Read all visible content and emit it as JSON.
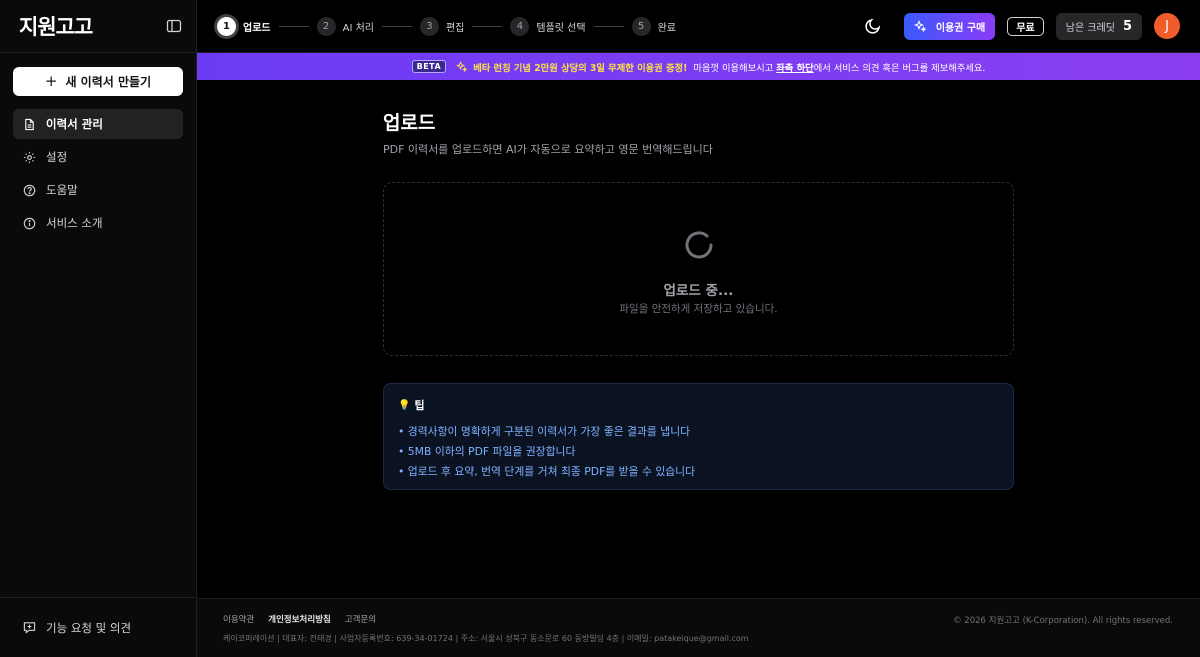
{
  "app": {
    "logo": "지원고고"
  },
  "sidebar": {
    "new_button": "새 이력서 만들기",
    "items": [
      {
        "label": "이력서 관리",
        "icon": "document-icon",
        "active": true
      },
      {
        "label": "설정",
        "icon": "gear-icon",
        "active": false
      },
      {
        "label": "도움말",
        "icon": "help-icon",
        "active": false
      },
      {
        "label": "서비스 소개",
        "icon": "info-icon",
        "active": false
      }
    ],
    "feedback": "기능 요청 및 의견"
  },
  "steps": [
    {
      "num": "1",
      "label": "업로드",
      "active": true
    },
    {
      "num": "2",
      "label": "AI 처리",
      "active": false
    },
    {
      "num": "3",
      "label": "편집",
      "active": false
    },
    {
      "num": "4",
      "label": "템플릿 선택",
      "active": false
    },
    {
      "num": "5",
      "label": "완료",
      "active": false
    }
  ],
  "header": {
    "buy_label": "이용권 구매",
    "plan": "무료",
    "credits_label": "남은 크레딧",
    "credits_value": "5",
    "avatar_initial": "J"
  },
  "banner": {
    "badge": "BETA",
    "highlight": "베타 런칭 기념 2만원 상당의 3일 무제한 이용권 증정!",
    "text_before": "마음껏 이용해보시고",
    "link": "좌측 하단",
    "text_after": "에서 서비스 의견 혹은 버그를 제보해주세요."
  },
  "main": {
    "title": "업로드",
    "subtitle": "PDF 이력서를 업로드하면 AI가 자동으로 요약하고 영문 번역해드립니다",
    "status": "업로드 중...",
    "status_sub": "파일을 안전하게 저장하고 있습니다."
  },
  "tips": {
    "title": "팁",
    "items": [
      "• 경력사항이 명확하게 구분된 이력서가 가장 좋은 결과를 냅니다",
      "• 5MB 이하의 PDF 파일을 권장합니다",
      "• 업로드 후 요약, 번역 단계를 거쳐 최종 PDF를 받을 수 있습니다"
    ]
  },
  "footer": {
    "links": [
      "이용약관",
      "개인정보처리방침",
      "고객문의"
    ],
    "info": "케이코퍼레이션  |  대표자: 전태경  |  사업자등록번호: 639-34-01724  |  주소: 서울시 성북구 동소문로 60 동방빌딩 4층  |  이메일: patakeique@gmail.com",
    "copyright": "© 2026 지원고고 (K-Corporation). All rights reserved."
  },
  "colors": {
    "accent_start": "#3b5bfd",
    "accent_end": "#8b3bf6",
    "banner": "#7a3df3",
    "avatar": "#f25c2a",
    "tip_text": "#7fb2ff"
  }
}
